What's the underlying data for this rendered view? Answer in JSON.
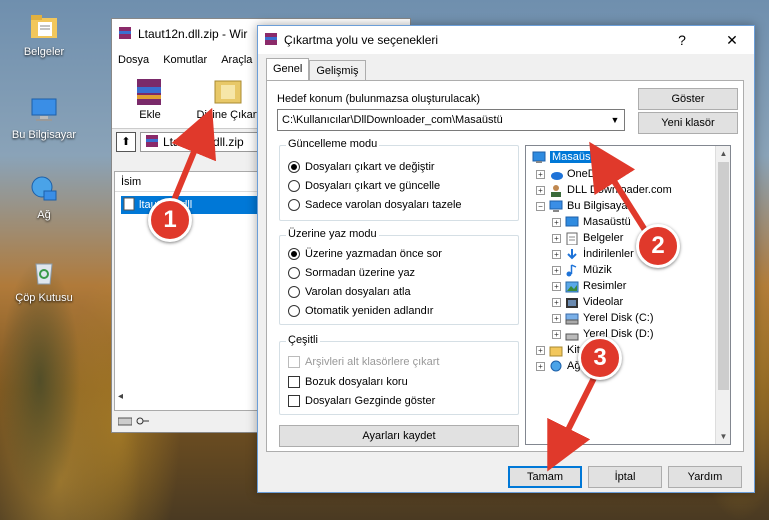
{
  "desktop": {
    "icons": [
      {
        "label": "Belgeler",
        "icon": "documents-folder-icon"
      },
      {
        "label": "Bu Bilgisayar",
        "icon": "computer-icon"
      },
      {
        "label": "Ağ",
        "icon": "network-icon"
      },
      {
        "label": "Çöp Kutusu",
        "icon": "recycle-bin-icon"
      }
    ]
  },
  "winrar": {
    "title": "Ltaut12n.dll.zip - Wir",
    "menu": [
      "Dosya",
      "Komutlar",
      "Araçla"
    ],
    "toolbar": {
      "add": "Ekle",
      "extract": "Dizine Çıkart"
    },
    "address": "Ltaut12n.dll.zip",
    "column_name": "İsim",
    "file": "ltaut12n.dll"
  },
  "dialog": {
    "title": "Çıkartma yolu ve seçenekleri",
    "help": "?",
    "close": "✕",
    "tabs": [
      "Genel",
      "Gelişmiş"
    ],
    "destination_label": "Hedef konum (bulunmazsa oluşturulacak)",
    "destination_value": "C:\\Kullanıcılar\\DllDownloader_com\\Masaüstü",
    "show_button": "Göster",
    "new_folder_button": "Yeni klasör",
    "update_mode": {
      "title": "Güncelleme modu",
      "options": [
        "Dosyaları çıkart ve değiştir",
        "Dosyaları çıkart ve güncelle",
        "Sadece varolan dosyaları tazele"
      ],
      "selected": 0
    },
    "overwrite_mode": {
      "title": "Üzerine yaz modu",
      "options": [
        "Üzerine yazmadan önce sor",
        "Sormadan üzerine yaz",
        "Varolan dosyaları atla",
        "Otomatik yeniden adlandır"
      ],
      "selected": 0
    },
    "misc": {
      "title": "Çeşitli",
      "options": [
        "Arşivleri alt klasörlere çıkart",
        "Bozuk dosyaları koru",
        "Dosyaları Gezginde göster"
      ],
      "disabled": [
        true,
        false,
        false
      ],
      "checked": [
        false,
        false,
        false
      ]
    },
    "save_settings": "Ayarları kaydet",
    "tree": [
      {
        "label": "Masaüstü",
        "icon": "desktop-icon",
        "expand": "",
        "selected": true
      },
      {
        "label": "OneDrive",
        "icon": "onedrive-icon",
        "expand": "+"
      },
      {
        "label": "DLL Downloader.com",
        "icon": "user-icon",
        "expand": "+"
      },
      {
        "label": "Bu Bilgisayar",
        "icon": "computer-icon",
        "expand": "−"
      },
      {
        "label": "Masaüstü",
        "icon": "desktop-icon",
        "expand": "+"
      },
      {
        "label": "Belgeler",
        "icon": "documents-icon",
        "expand": "+"
      },
      {
        "label": "İndirilenler",
        "icon": "downloads-icon",
        "expand": "+"
      },
      {
        "label": "Müzik",
        "icon": "music-icon",
        "expand": "+"
      },
      {
        "label": "Resimler",
        "icon": "pictures-icon",
        "expand": "+"
      },
      {
        "label": "Videolar",
        "icon": "videos-icon",
        "expand": "+"
      },
      {
        "label": "Yerel Disk (C:)",
        "icon": "drive-icon",
        "expand": "+"
      },
      {
        "label": "Yerel Disk (D:)",
        "icon": "drive-icon",
        "expand": "+"
      },
      {
        "label": "Kitap",
        "icon": "library-icon",
        "expand": "+"
      },
      {
        "label": "Ağ",
        "icon": "network-icon",
        "expand": "+"
      }
    ],
    "ok": "Tamam",
    "cancel": "İptal",
    "help_button": "Yardım"
  },
  "markers": [
    "1",
    "2",
    "3"
  ],
  "colors": {
    "marker": "#e0392b",
    "selection": "#0078d7"
  }
}
